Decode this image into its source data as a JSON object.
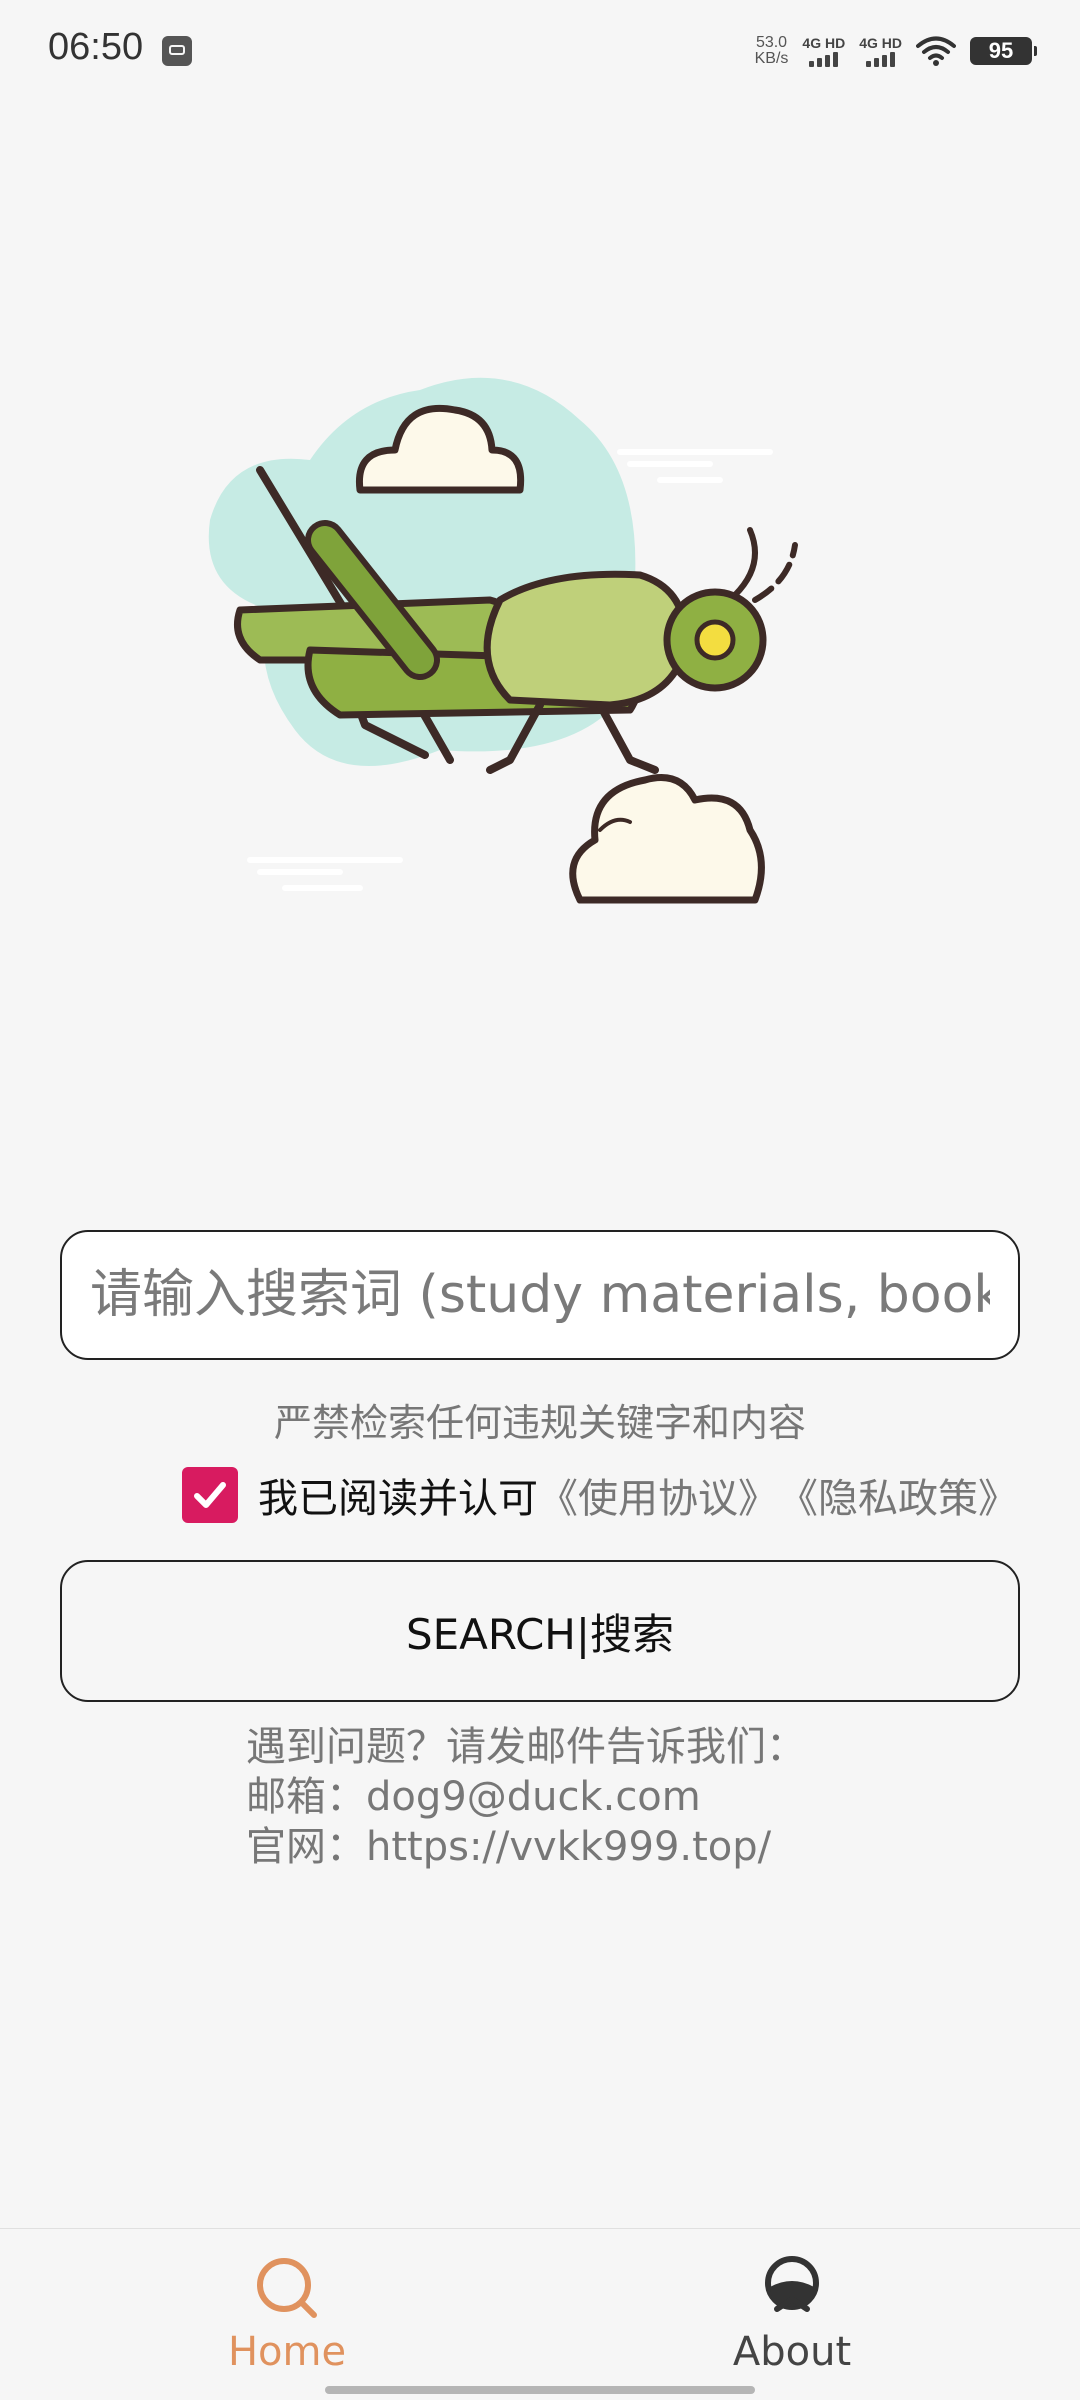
{
  "status_bar": {
    "time": "06:50",
    "net_speed_value": "53.0",
    "net_speed_unit": "KB/s",
    "sim1_label": "4G HD",
    "sim2_label": "4G HD",
    "battery": "95"
  },
  "search": {
    "placeholder": "请输入搜索词 (study materials, book",
    "warning": "严禁检索任何违规关键字和内容",
    "agree_checked": true,
    "agree_text": "我已阅读并认可",
    "terms_link": "《使用协议》",
    "privacy_link": "《隐私政策》",
    "button_label": "SEARCH|搜索"
  },
  "contact": {
    "line1": "遇到问题？请发邮件告诉我们：",
    "line2": " 邮箱：dog9@duck.com",
    "line3": "官网：https://vvkk999.top/"
  },
  "bottom_nav": {
    "home_label": "Home",
    "about_label": "About",
    "active_color": "#e0925e"
  },
  "colors": {
    "checkbox": "#d81b60",
    "background": "#f6f6f6"
  }
}
